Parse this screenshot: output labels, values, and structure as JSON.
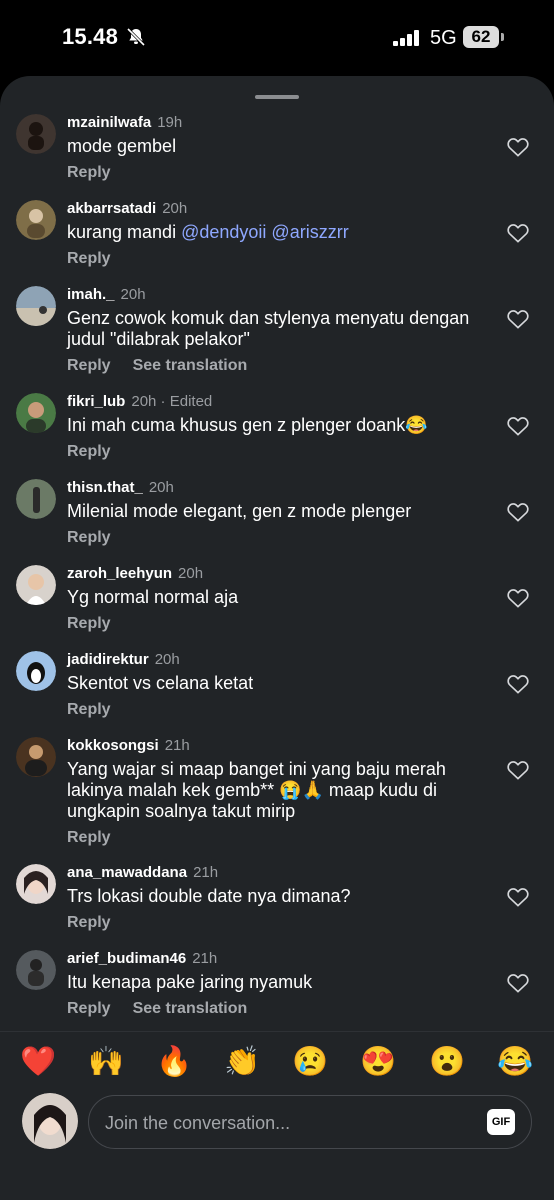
{
  "status_bar": {
    "time": "15.48",
    "network": "5G",
    "battery": "62"
  },
  "comments": [
    {
      "user": "mzainilwafa",
      "time": "19h",
      "text": "mode gembel",
      "actions": [
        "Reply"
      ],
      "avatar_color": "#3f3530"
    },
    {
      "user": "akbarrsatadi",
      "time": "20h",
      "text_prefix": "kurang mandi ",
      "mentions": [
        "@dendyoii",
        "@ariszzrr"
      ],
      "actions": [
        "Reply"
      ],
      "avatar_color": "#7f6e48"
    },
    {
      "user": "imah._",
      "time": "20h",
      "text": "Genz cowok komuk dan stylenya menyatu dengan judul \"dilabrak pelakor\"",
      "actions": [
        "Reply",
        "See translation"
      ],
      "avatar_color": "#8ea3b5"
    },
    {
      "user": "fikri_lub",
      "time": "20h · Edited",
      "text": "Ini mah cuma khusus gen z plenger doank😂",
      "actions": [
        "Reply"
      ],
      "avatar_color": "#4a7a45"
    },
    {
      "user": "thisn.that_",
      "time": "20h",
      "text": "Milenial mode elegant, gen z mode plenger",
      "actions": [
        "Reply"
      ],
      "avatar_color": "#6b7a66"
    },
    {
      "user": "zaroh_leehyun",
      "time": "20h",
      "text": "Yg normal normal aja",
      "actions": [
        "Reply"
      ],
      "avatar_color": "#d8d2cc"
    },
    {
      "user": "jadidirektur",
      "time": "20h",
      "text": "Skentot vs celana ketat",
      "actions": [
        "Reply"
      ],
      "avatar_color": "#9fc2e7"
    },
    {
      "user": "kokkosongsi",
      "time": "21h",
      "text": "Yang wajar si maap banget ini yang baju merah lakinya malah kek gemb** 😭🙏  maap kudu di ungkapin soalnya takut mirip",
      "actions": [
        "Reply"
      ],
      "avatar_color": "#4a3320"
    },
    {
      "user": "ana_mawaddana",
      "time": "21h",
      "text": "Trs lokasi double date nya dimana?",
      "actions": [
        "Reply"
      ],
      "avatar_color": "#e2d8d5"
    },
    {
      "user": "arief_budiman46",
      "time": "21h",
      "text": "Itu kenapa pake jaring nyamuk",
      "actions": [
        "Reply",
        "See translation"
      ],
      "avatar_color": "#555a5e"
    }
  ],
  "reactions": [
    "❤️",
    "🙌",
    "🔥",
    "👏",
    "😢",
    "😍",
    "😮",
    "😂"
  ],
  "composer": {
    "placeholder": "Join the conversation...",
    "gif_label": "GIF"
  },
  "colors": {
    "sheet": "#212427",
    "mention": "#8fa8ff",
    "muted": "#9a9da1"
  }
}
